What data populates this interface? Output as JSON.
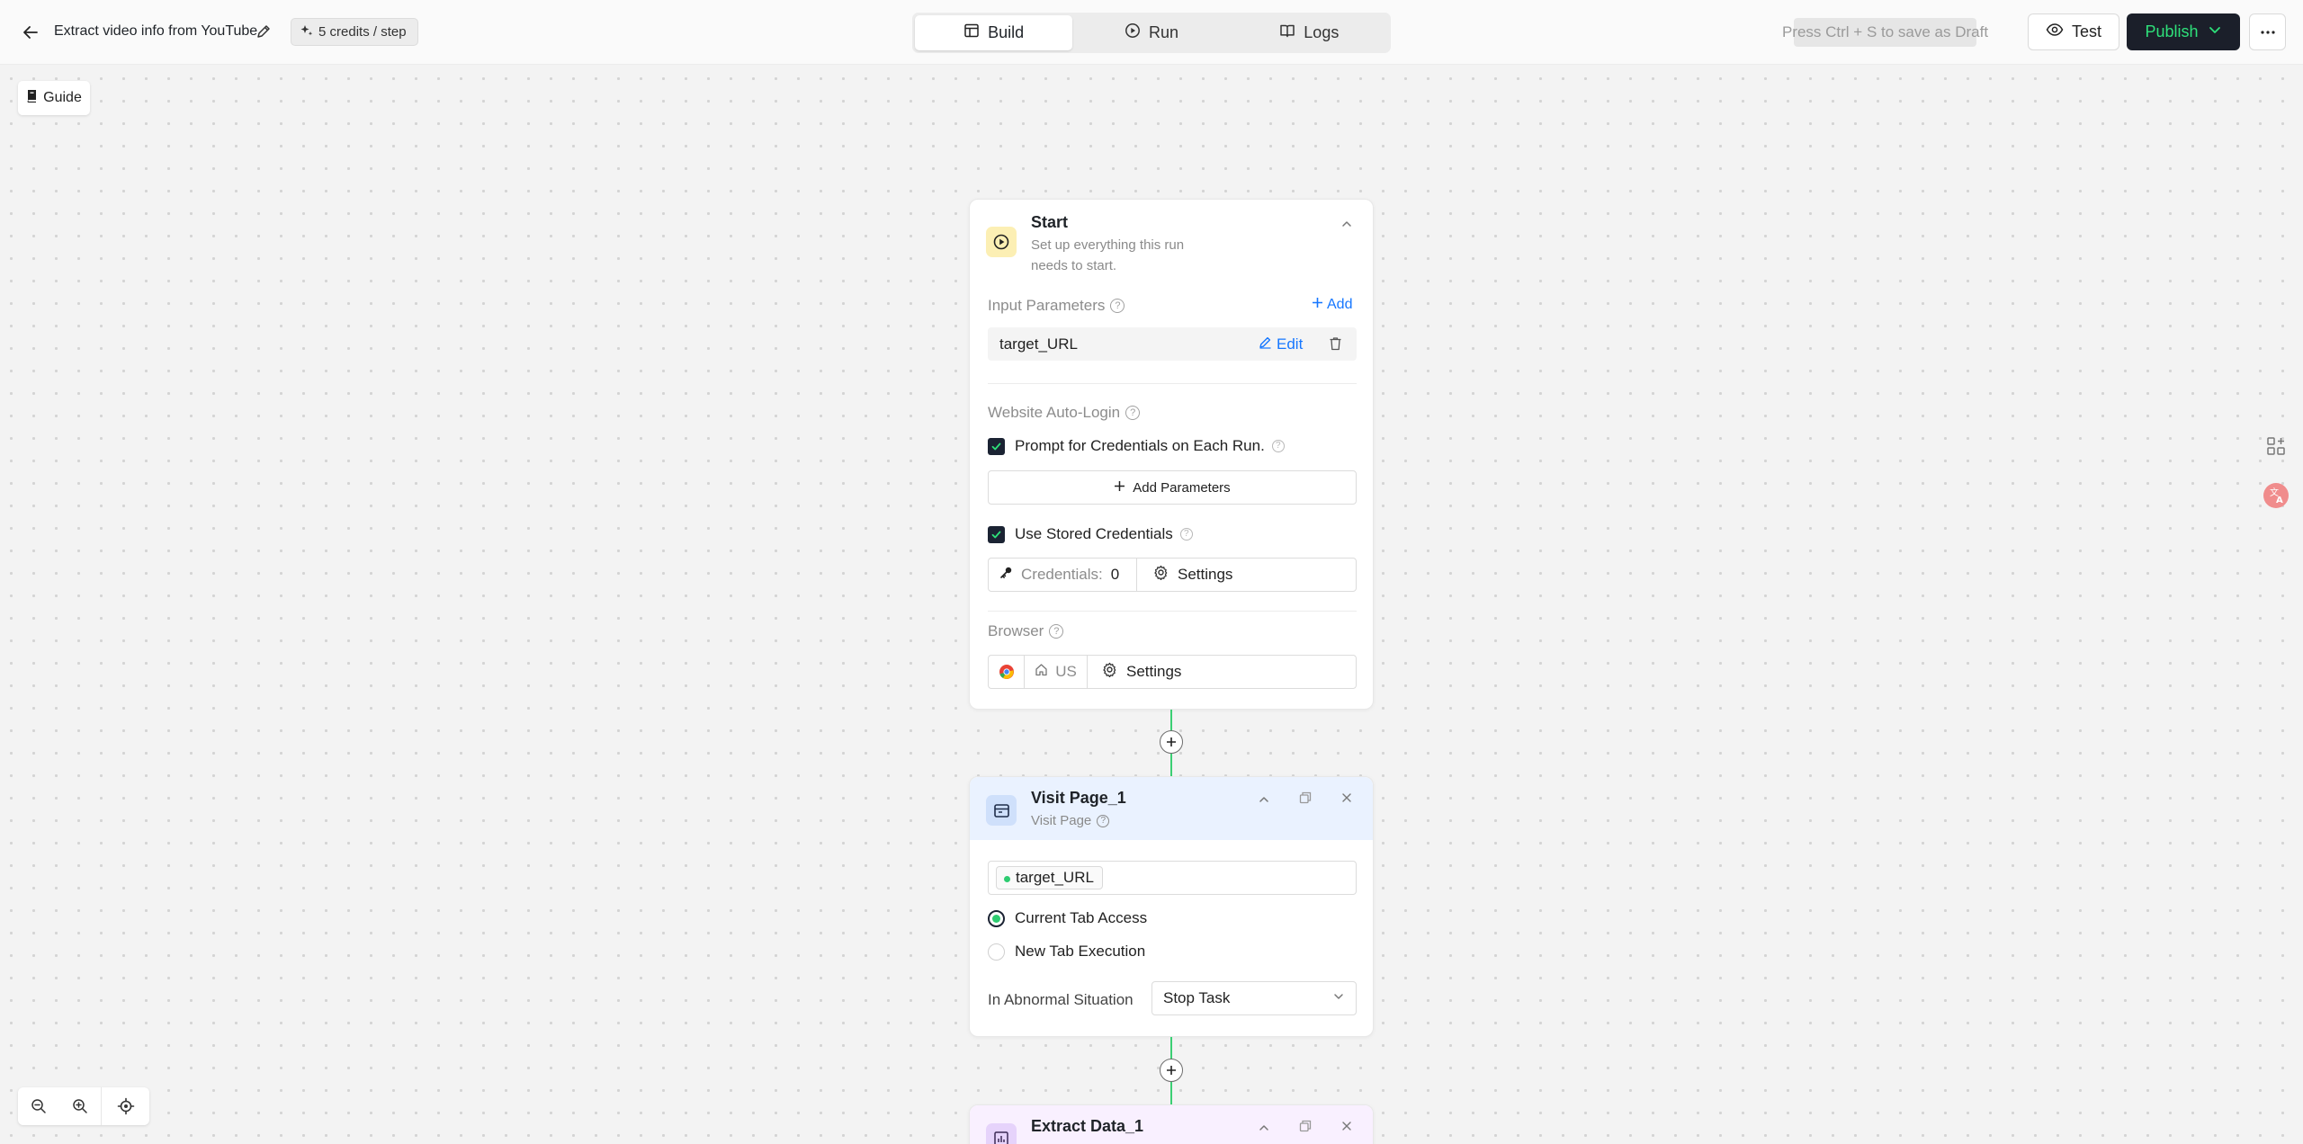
{
  "header": {
    "title": "Extract video info from YouTube",
    "credits": "5 credits / step",
    "tabs": [
      {
        "label": "Build",
        "active": true
      },
      {
        "label": "Run",
        "active": false
      },
      {
        "label": "Logs",
        "active": false
      }
    ],
    "draft_hint": "Press Ctrl + S to save as Draft",
    "test_label": "Test",
    "publish_label": "Publish"
  },
  "guide_label": "Guide",
  "start_node": {
    "title": "Start",
    "subtitle_line1": "Set up everything this run",
    "subtitle_line2": "needs to start.",
    "input_params_label": "Input Parameters",
    "add_label": "Add",
    "param_name": "target_URL",
    "edit_label": "Edit",
    "auto_login_label": "Website Auto-Login",
    "prompt_credentials_label": "Prompt for Credentials on Each Run.",
    "prompt_credentials_checked": true,
    "add_parameters_label": "Add Parameters",
    "stored_credentials_label": "Use Stored Credentials",
    "stored_credentials_checked": true,
    "credentials_label": "Credentials:",
    "credentials_count": "0",
    "settings_label": "Settings",
    "browser_label": "Browser",
    "browser_region": "US",
    "browser_settings_label": "Settings"
  },
  "visit_node": {
    "title": "Visit Page_1",
    "subtitle": "Visit Page",
    "url_chip": "target_URL",
    "options": [
      {
        "label": "Current Tab Access",
        "selected": true
      },
      {
        "label": "New Tab Execution",
        "selected": false
      }
    ],
    "abnormal_label": "In Abnormal Situation",
    "abnormal_value": "Stop Task"
  },
  "extract_node": {
    "title": "Extract Data_1"
  },
  "colors": {
    "accent_blue": "#1677ff",
    "connector_green": "#3ccf74",
    "publish_bg": "#1b1f2a",
    "publish_text": "#2ee07a"
  }
}
